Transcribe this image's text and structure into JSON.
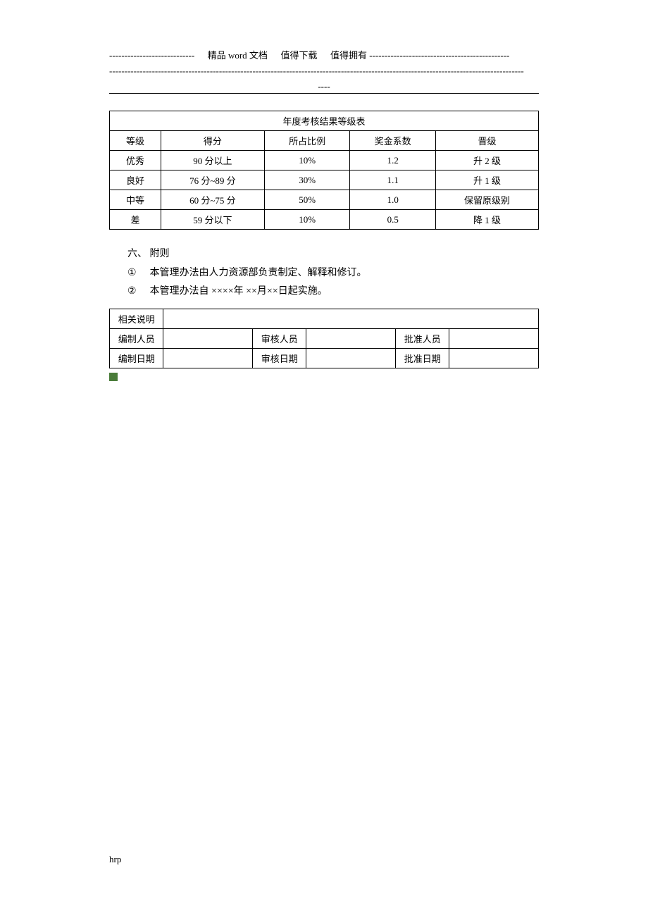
{
  "header": {
    "line1_left": "----------------------------",
    "line1_mid": "精品 word 文档",
    "line1_sep1": "值得下载",
    "line1_sep2": "值得拥有",
    "line1_right": "----------------------------------------------",
    "line2": "----------------------------------------------------------------------------------------------------------------------------------------",
    "line3_pre": "",
    "line3": "----"
  },
  "table1": {
    "title": "年度考核结果等级表",
    "headers": [
      "等级",
      "得分",
      "所占比例",
      "奖金系数",
      "晋级"
    ],
    "rows": [
      [
        "优秀",
        "90 分以上",
        "10%",
        "1.2",
        "升 2 级"
      ],
      [
        "良好",
        "76 分~89 分",
        "30%",
        "1.1",
        "升 1 级"
      ],
      [
        "中等",
        "60 分~75 分",
        "50%",
        "1.0",
        "保留原级别"
      ],
      [
        "差",
        "59 分以下",
        "10%",
        "0.5",
        "降 1 级"
      ]
    ]
  },
  "section": {
    "heading": "六、 附则",
    "item1_marker": "①",
    "item1_text": "本管理办法由人力资源部负责制定、解释和修订。",
    "item2_marker": "②",
    "item2_text": "本管理办法自   ××××年 ××月××日起实施。"
  },
  "table2": {
    "row1_label": "相关说明",
    "row2": [
      "编制人员",
      "",
      "审核人员",
      "",
      "批准人员",
      ""
    ],
    "row3": [
      "编制日期",
      "",
      "审核日期",
      "",
      "批准日期",
      ""
    ]
  },
  "footer": {
    "text": "hrp"
  }
}
